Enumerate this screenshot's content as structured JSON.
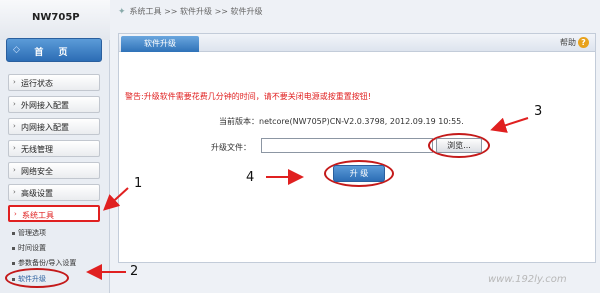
{
  "brand": {
    "model": "NW705P"
  },
  "sidebar": {
    "home_icon": "◇",
    "home_label": "首 页",
    "items": [
      {
        "label": "运行状态"
      },
      {
        "label": "外网接入配置"
      },
      {
        "label": "内网接入配置"
      },
      {
        "label": "无线管理"
      },
      {
        "label": "网络安全"
      },
      {
        "label": "高级设置"
      },
      {
        "label": "系统工具"
      }
    ],
    "sub_items": [
      {
        "label": "管理选项"
      },
      {
        "label": "时间设置"
      },
      {
        "label": "参数备份/导入设置"
      },
      {
        "label": "软件升级"
      }
    ]
  },
  "breadcrumb": {
    "icon": "✦",
    "text": "系统工具 >> 软件升级 >> 软件升级"
  },
  "panel": {
    "tab_label": "软件升级",
    "help_label": "帮助",
    "help_icon": "?",
    "warning": "警告:升级软件需要花费几分钟的时间，请不要关闭电源或按重置按钮!",
    "version_label": "当前版本：",
    "version_value": "netcore(NW705P)CN-V2.0.3798, 2012.09.19 10:55.",
    "file_label": "升级文件：",
    "file_value": "",
    "browse_label": "浏览...",
    "upgrade_label": "升 级"
  },
  "annotations": {
    "n1": "1",
    "n2": "2",
    "n3": "3",
    "n4": "4"
  },
  "watermark": "www.192ly.com",
  "colors": {
    "accent_blue": "#2c6db5",
    "highlight_red": "#c41a1a",
    "warning_red": "#e02020"
  }
}
